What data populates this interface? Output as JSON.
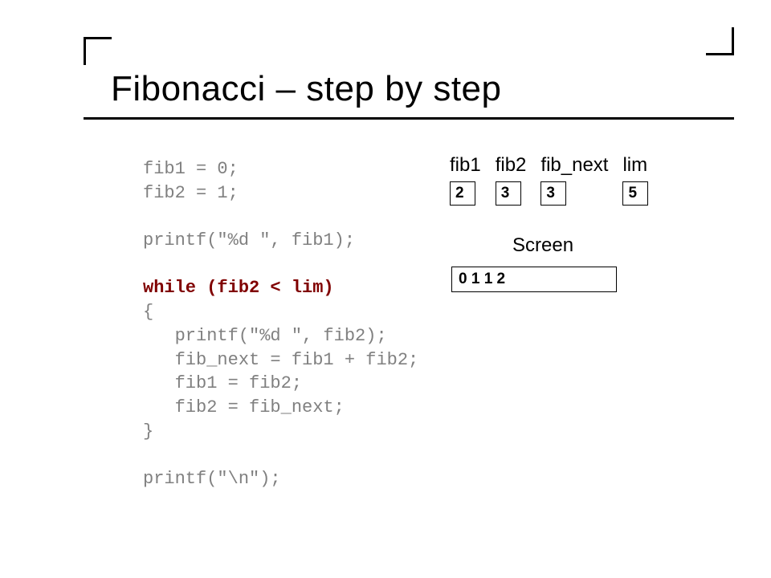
{
  "title": "Fibonacci – step by step",
  "code": {
    "line1": "fib1 = 0;",
    "line2": "fib2 = 1;",
    "line3": "",
    "line4": "printf(\"%d \", fib1);",
    "line5": "",
    "line6_hl": "while (fib2 < lim)",
    "line7": "{",
    "line8": "   printf(\"%d \", fib2);",
    "line9": "   fib_next = fib1 + fib2;",
    "line10": "   fib1 = fib2;",
    "line11": "   fib2 = fib_next;",
    "line12": "}",
    "line13": "",
    "line14": "printf(\"\\n\");"
  },
  "vars": [
    {
      "label": "fib1",
      "value": "2"
    },
    {
      "label": "fib2",
      "value": "3"
    },
    {
      "label": "fib_next",
      "value": "3"
    },
    {
      "label": "lim",
      "value": "5"
    }
  ],
  "screen": {
    "label": "Screen",
    "output": "0 1 1 2"
  }
}
